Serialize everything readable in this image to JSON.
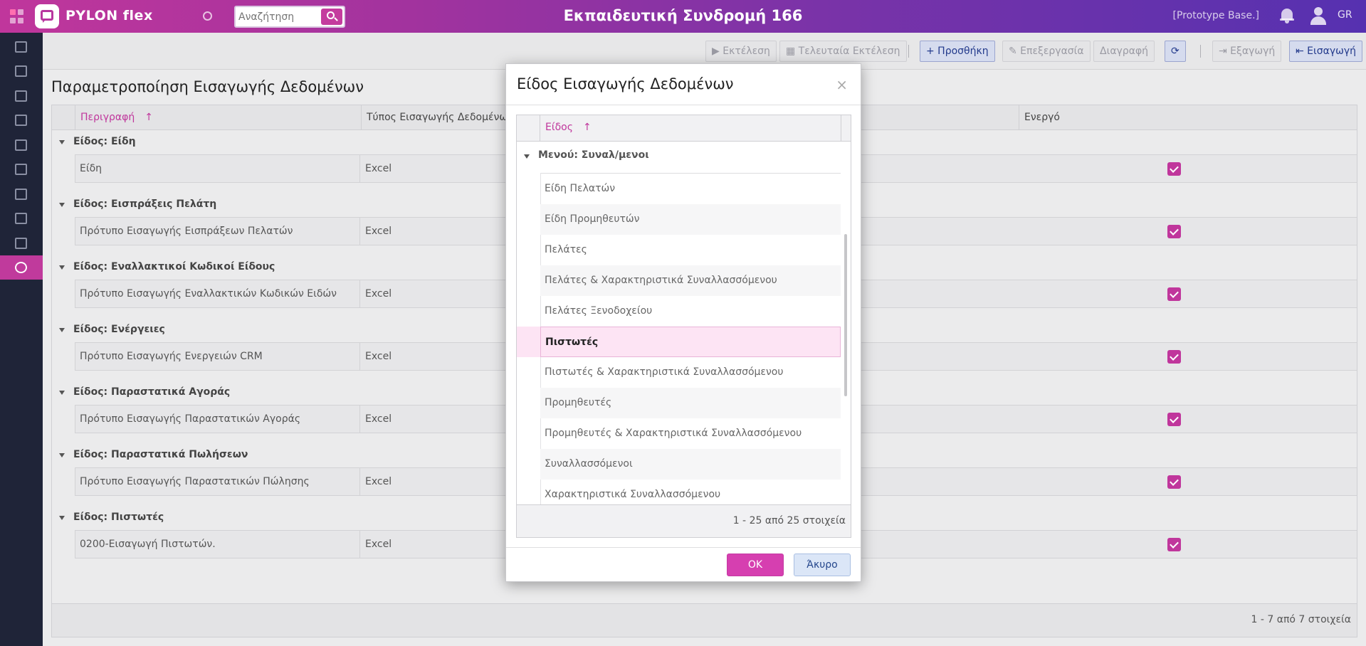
{
  "topbar": {
    "logo_text": "PYLON flex",
    "search_placeholder": "Αναζήτηση",
    "title": "Εκπαιδευτική Συνδρομή 166",
    "database": "[Prototype Base.]",
    "language": "GR"
  },
  "toolbar": {
    "execute": "▶ Εκτέλεση",
    "last_execute": "▦ Τελευταία Εκτέλεση",
    "add": "+ Προσθήκη",
    "edit": "✎ Επεξεργασία",
    "delete": "Διαγραφή",
    "refresh": "⟳",
    "export": "⇥ Εξαγωγή",
    "import": "⇤ Εισαγωγή"
  },
  "page": {
    "title": "Παραμετροποίηση Εισαγωγής Δεδομένων",
    "columns": {
      "description": "Περιγραφή",
      "type": "Τύπος Εισαγωγής Δεδομένων",
      "active": "Ενεργό"
    },
    "sort_arrow": "↑",
    "groups": [
      {
        "title": "Είδος: Είδη",
        "row": "Είδη",
        "type": "Excel"
      },
      {
        "title": "Είδος: Εισπράξεις Πελάτη",
        "row": "Πρότυπο Εισαγωγής Εισπράξεων Πελατών",
        "type": "Excel"
      },
      {
        "title": "Είδος: Εναλλακτικοί Κωδικοί Είδους",
        "row": "Πρότυπο Εισαγωγής Εναλλακτικών Κωδικών Ειδών",
        "type": "Excel"
      },
      {
        "title": "Είδος: Ενέργειες",
        "row": "Πρότυπο Εισαγωγής Ενεργειών CRM",
        "type": "Excel"
      },
      {
        "title": "Είδος: Παραστατικά Αγοράς",
        "row": "Πρότυπο Εισαγωγής Παραστατικών Αγοράς",
        "type": "Excel"
      },
      {
        "title": "Είδος: Παραστατικά Πωλήσεων",
        "row": "Πρότυπο Εισαγωγής Παραστατικών Πώλησης",
        "type": "Excel"
      },
      {
        "title": "Είδος: Πιστωτές",
        "row": "0200-Εισαγωγή Πιστωτών.",
        "type": "Excel"
      }
    ],
    "pager": "1 - 7 από 7 στοιχεία"
  },
  "modal": {
    "title": "Είδος Εισαγωγής Δεδομένων",
    "close": "×",
    "column": "Είδος",
    "group": "Μενού: Συναλ/μενοι",
    "items": [
      "Είδη Πελατών",
      "Είδη Προμηθευτών",
      "Πελάτες",
      "Πελάτες & Χαρακτηριστικά Συναλλασσόμενου",
      "Πελάτες Ξενοδοχείου",
      "Πιστωτές",
      "Πιστωτές & Χαρακτηριστικά Συναλλασσόμενου",
      "Προμηθευτές",
      "Προμηθευτές & Χαρακτηριστικά Συναλλασσόμενου",
      "Συναλλασσόμενοι",
      "Χαρακτηριστικά Συναλλασσόμενου"
    ],
    "selected_index": 5,
    "pager": "1 - 25 από 25 στοιχεία",
    "ok": "OK",
    "cancel": "Άκυρο"
  }
}
